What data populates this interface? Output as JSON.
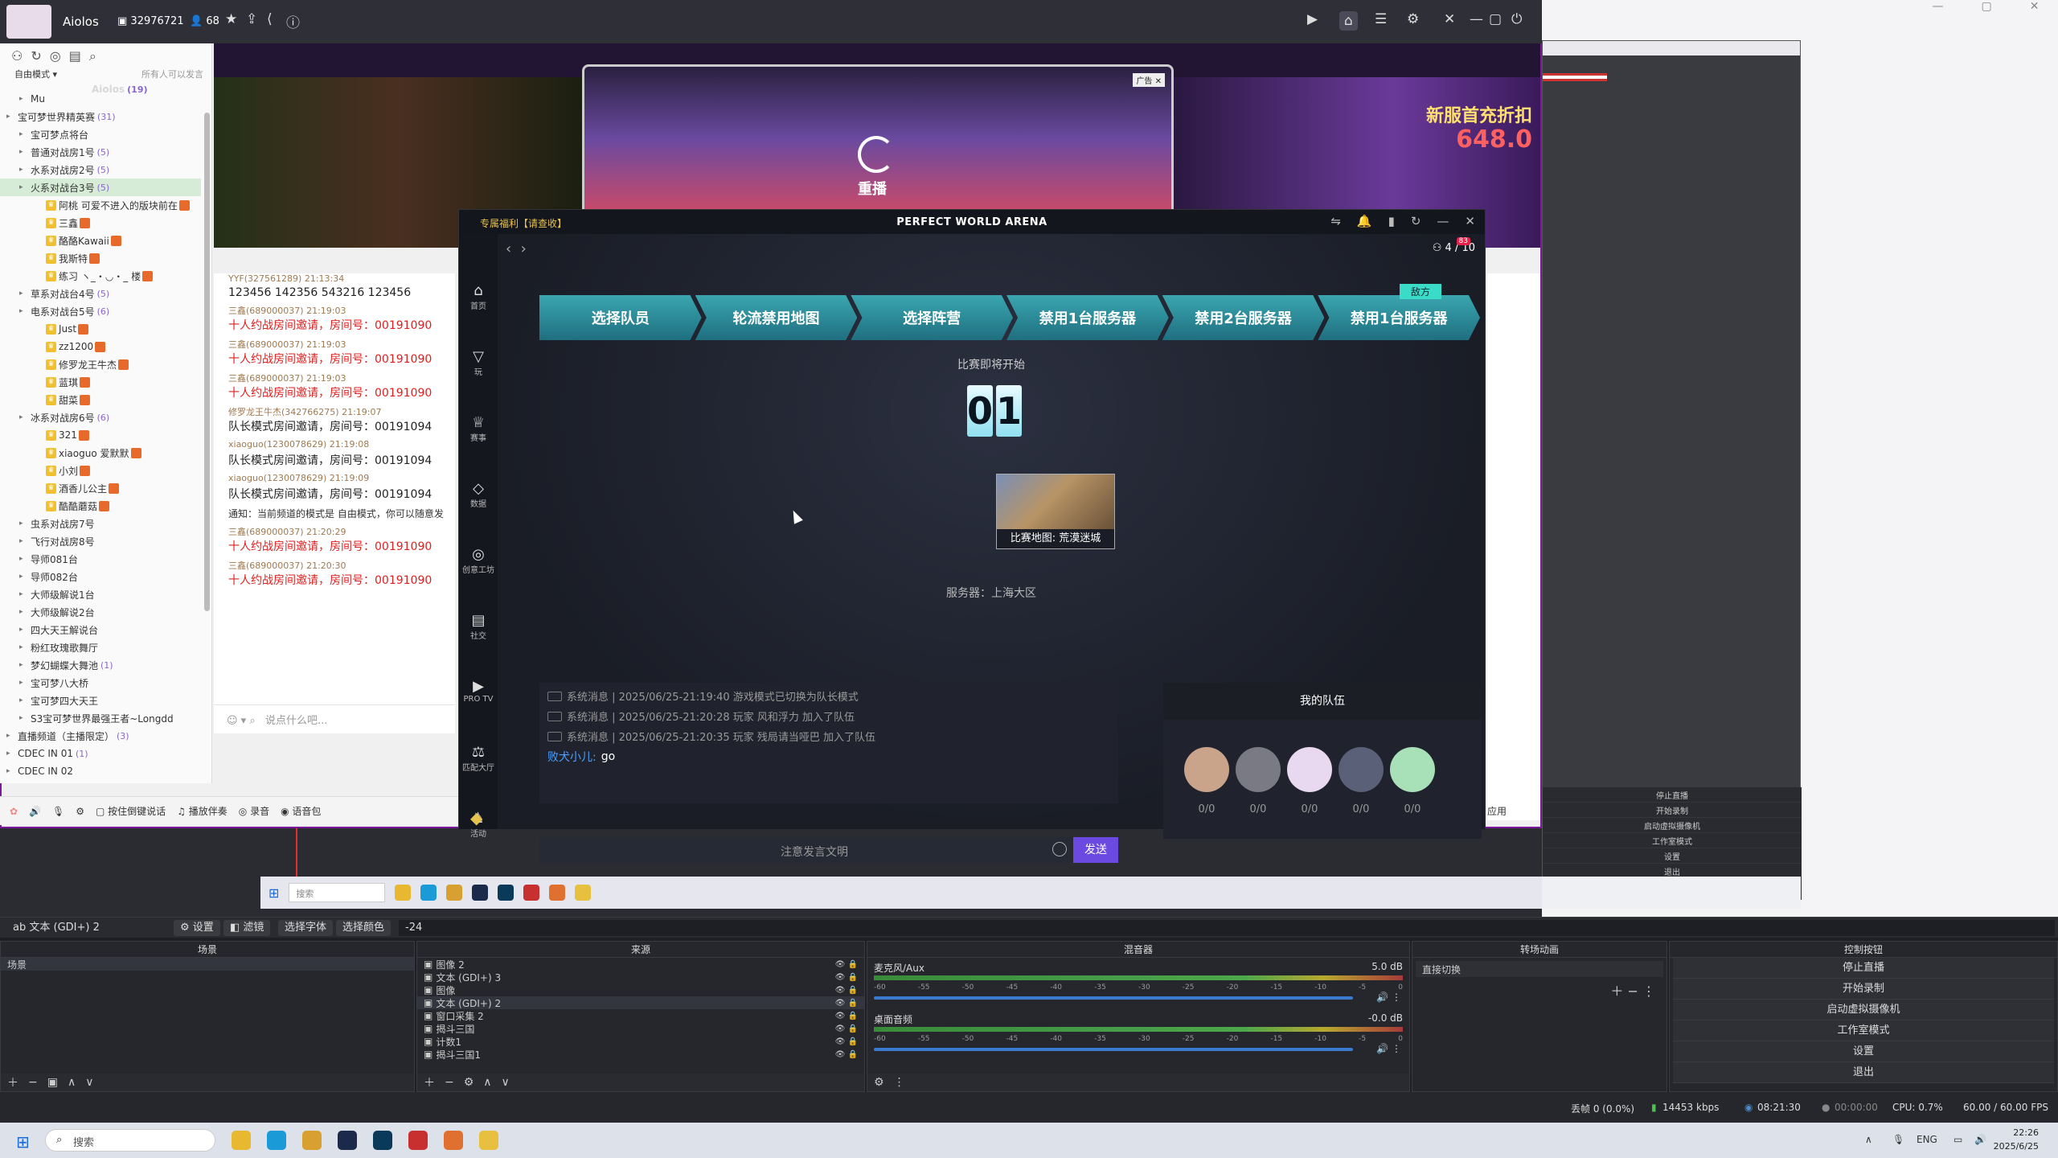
{
  "yy": {
    "channel_name": "Aiolos",
    "channel_id": "32976721",
    "online_count": "68",
    "left_mode": "自由模式 ▾",
    "left_mode_hint": "所有人可以发言",
    "tree_header": "Aiolos",
    "tree_header_count": "(19)",
    "tree": [
      {
        "label": "Mu",
        "indent": 1
      },
      {
        "label": "宝可梦世界精英赛",
        "count": "(31)",
        "indent": 0
      },
      {
        "label": "宝可梦点将台",
        "indent": 1
      },
      {
        "label": "普通对战房1号",
        "count": "(5)",
        "indent": 1
      },
      {
        "label": "水系对战房2号",
        "count": "(5)",
        "indent": 1
      },
      {
        "label": "火系对战台3号",
        "count": "(5)",
        "indent": 1,
        "selected": true
      },
      {
        "label": "阿桃 可爱不进入的版块前在",
        "indent": 2
      },
      {
        "label": "三鑫",
        "indent": 2
      },
      {
        "label": "酪酪Kawaii",
        "indent": 2
      },
      {
        "label": "我斯特",
        "indent": 2
      },
      {
        "label": "练习 ヽ_・◡・_ 楼",
        "indent": 2
      },
      {
        "label": "草系对战台4号",
        "count": "(5)",
        "indent": 1
      },
      {
        "label": "电系对战台5号",
        "count": "(6)",
        "indent": 1
      },
      {
        "label": "Just",
        "indent": 2
      },
      {
        "label": "zz1200",
        "indent": 2
      },
      {
        "label": "修罗龙王牛杰",
        "indent": 2
      },
      {
        "label": "蓝琪",
        "indent": 2
      },
      {
        "label": "甜菜",
        "indent": 2
      },
      {
        "label": "冰系对战房6号",
        "count": "(6)",
        "indent": 1
      },
      {
        "label": "321",
        "indent": 2
      },
      {
        "label": "xiaoguo 爱默默",
        "indent": 2
      },
      {
        "label": "小刘",
        "indent": 2
      },
      {
        "label": "酒香儿公主",
        "indent": 2
      },
      {
        "label": "酷酷蘑菇",
        "indent": 2
      },
      {
        "label": "虫系对战房7号",
        "indent": 1
      },
      {
        "label": "飞行对战房8号",
        "indent": 1
      },
      {
        "label": "导师081台",
        "indent": 1
      },
      {
        "label": "导师082台",
        "indent": 1
      },
      {
        "label": "大师级解说1台",
        "indent": 1
      },
      {
        "label": "大师级解说2台",
        "indent": 1
      },
      {
        "label": "四大天王解说台",
        "indent": 1
      },
      {
        "label": "粉红玫瑰歌舞厅",
        "indent": 1
      },
      {
        "label": "梦幻蝴蝶大舞池",
        "count": "(1)",
        "indent": 1
      },
      {
        "label": "宝可梦八大桥",
        "indent": 1
      },
      {
        "label": "宝可梦四大天王",
        "indent": 1
      },
      {
        "label": "S3宝可梦世界最强王者~Longdd",
        "indent": 1
      },
      {
        "label": "直播频道（主播限定）",
        "count": "(3)",
        "indent": 0
      },
      {
        "label": "CDEC IN 01",
        "count": "(1)",
        "indent": 0
      },
      {
        "label": "CDEC IN 02",
        "indent": 0
      }
    ],
    "chat": [
      {
        "who": "YYF(327561289) 21:13:34",
        "text": "123456 142356 543216 123456",
        "style": "normal"
      },
      {
        "who": "三鑫(689000037) 21:19:03",
        "text": "十人约战房间邀请，房间号：00191090",
        "style": "red"
      },
      {
        "who": "三鑫(689000037) 21:19:03",
        "text": "十人约战房间邀请，房间号：00191090",
        "style": "red"
      },
      {
        "who": "三鑫(689000037) 21:19:03",
        "text": "十人约战房间邀请，房间号：00191090",
        "style": "red"
      },
      {
        "who": "修罗龙王牛杰(342766275) 21:19:07",
        "text": "队长模式房间邀请，房间号：00191094",
        "style": "normal"
      },
      {
        "who": "xiaoguo(1230078629) 21:19:08",
        "text": "队长模式房间邀请，房间号：00191094",
        "style": "normal"
      },
      {
        "who": "xiaoguo(1230078629) 21:19:09",
        "text": "队长模式房间邀请，房间号：00191094",
        "style": "normal"
      },
      {
        "who": "",
        "text": "通知：当前频道的模式是 自由模式，你可以随意发",
        "style": "notice"
      },
      {
        "who": "三鑫(689000037) 21:20:29",
        "text": "十人约战房间邀请，房间号：00191090",
        "style": "red"
      },
      {
        "who": "三鑫(689000037) 21:20:30",
        "text": "十人约战房间邀请，房间号：00191090",
        "style": "red"
      }
    ],
    "chat_placeholder": "说点什么吧...",
    "bottom": [
      "按住倒键说话",
      "播放伴奏",
      "录音",
      "语音包"
    ],
    "banner_replay": "重播",
    "banner_t1": "新服首充折扣",
    "banner_t2": "648.0",
    "rightbar_app": "应用"
  },
  "pwa": {
    "badge": "专属福利【请查收】",
    "title": "PERFECT WORLD ARENA",
    "counter": "4 / 10",
    "counter_badge": "83",
    "nav": [
      "首页",
      "玩",
      "赛事",
      "数据",
      "创意工坊",
      "社交",
      "PRO TV",
      "匹配大厅",
      "活动"
    ],
    "steps": [
      "选择队员",
      "轮流禁用地图",
      "选择阵营",
      "禁用1台服务器",
      "禁用2台服务器",
      "禁用1台服务器"
    ],
    "enemy": "敌方",
    "begin": "比赛即将开始",
    "digit1": "0",
    "digit2": "1",
    "map_label": "比赛地图: 荒漠迷城",
    "server": "服务器：上海大区",
    "sys_msgs": [
      "系统消息 | 2025/06/25-21:19:40 游戏模式已切换为队长模式",
      "系统消息 | 2025/06/25-21:20:28 玩家 风和浮力 加入了队伍",
      "系统消息 | 2025/06/25-21:20:35 玩家 残局请当哑巴 加入了队伍"
    ],
    "user_msg": {
      "name": "败犬小儿:",
      "text": "go"
    },
    "chat_placeholder": "注意发言文明",
    "send": "发送",
    "team_title": "我的队伍",
    "players": [
      "0/0",
      "0/0",
      "0/0",
      "0/0",
      "0/0"
    ],
    "avatar_colors": [
      "#c9a48a",
      "#7a7a84",
      "#e8d8f0",
      "#5a6078",
      "#a8e0b8"
    ]
  },
  "obs": {
    "source_label": "文本 (GDI+) 2",
    "bar_buttons": [
      "设置",
      "滤镜",
      "选择字体",
      "选择颜色"
    ],
    "bar_value": "-24",
    "docks": {
      "scenes": "场景",
      "sources": "来源",
      "mixer": "混音器",
      "transitions": "转场动画",
      "controls": "控制按钮"
    },
    "scene_item": "场景",
    "sources": [
      "图像 2",
      "文本 (GDI+) 3",
      "图像",
      "文本 (GDI+) 2",
      "窗口采集 2",
      "揭斗三国",
      "计数1",
      "揭斗三国1"
    ],
    "mixer": [
      {
        "name": "麦克风/Aux",
        "db": "5.0 dB"
      },
      {
        "name": "桌面音频",
        "db": "-0.0 dB"
      }
    ],
    "mixer_scale": [
      "-60",
      "-55",
      "-50",
      "-45",
      "-40",
      "-35",
      "-30",
      "-25",
      "-20",
      "-15",
      "-10",
      "-5",
      "0"
    ],
    "transition": "直接切换",
    "controls": [
      "停止直播",
      "开始录制",
      "启动虚拟摄像机",
      "工作室模式",
      "设置",
      "退出"
    ],
    "status": {
      "dropped": "丢帧 0 (0.0%)",
      "bitrate": "14453 kbps",
      "live_time": "08:21:30",
      "rec_time": "00:00:00",
      "cpu": "CPU: 0.7%",
      "fps": "60.00 / 60.00 FPS"
    }
  },
  "taskbar": {
    "search": "搜索",
    "lang": "ENG",
    "time": "22:26",
    "date": "2025/6/25"
  },
  "inner_taskbar": {
    "search": "搜索"
  }
}
